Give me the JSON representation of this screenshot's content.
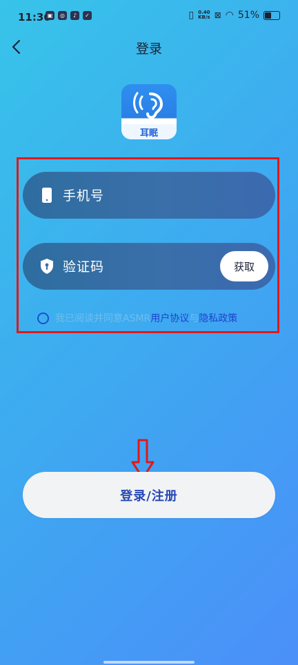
{
  "status_bar": {
    "time": "11:36",
    "speed_value": "0.40",
    "speed_unit": "KB/s",
    "battery": "51%",
    "battery_level": 0.51
  },
  "nav": {
    "title": "登录"
  },
  "app": {
    "name": "耳眠"
  },
  "form": {
    "phone_label": "手机号",
    "code_label": "验证码",
    "get_code_button": "获取",
    "agreement_prefix": "我已阅读并同意ASMR",
    "agreement_link1": "用户协议",
    "agreement_and": "与",
    "agreement_link2": "隐私政策"
  },
  "login_button": "登录/注册",
  "colors": {
    "bg_start": "#37c4e9",
    "bg_end": "#4b8ff9",
    "accent_blue": "#1d43cc",
    "highlight_red": "#e01818"
  }
}
